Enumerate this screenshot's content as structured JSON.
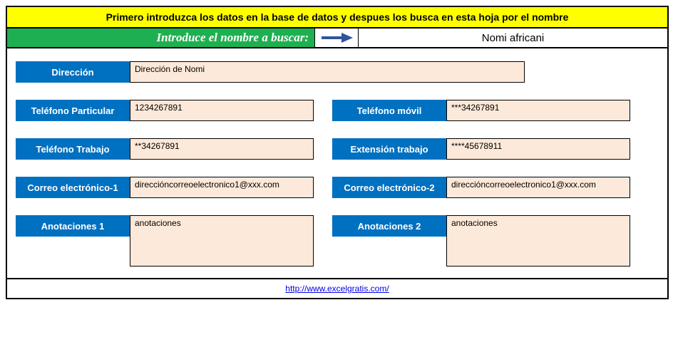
{
  "header": {
    "instruction": "Primero introduzca los datos en la base de datos y despues los busca en esta hoja por el nombre",
    "search_prompt": "Introduce el nombre a buscar:",
    "search_value": "Nomi africani"
  },
  "fields": {
    "direccion": {
      "label": "Dirección",
      "value": "Dirección de Nomi"
    },
    "tel_particular": {
      "label": "Teléfono Particular",
      "value": "1234267891"
    },
    "tel_movil": {
      "label": "Teléfono móvil",
      "value": "***34267891"
    },
    "tel_trabajo": {
      "label": "Teléfono Trabajo",
      "value": "**34267891"
    },
    "ext_trabajo": {
      "label": "Extensión trabajo",
      "value": "****45678911"
    },
    "correo1": {
      "label": "Correo electrónico-1",
      "value": "direccióncorreoelectronico1@xxx.com"
    },
    "correo2": {
      "label": "Correo electrónico-2",
      "value": "direccióncorreoelectronico1@xxx.com"
    },
    "anot1": {
      "label": "Anotaciones 1",
      "value": "anotaciones"
    },
    "anot2": {
      "label": "Anotaciones 2",
      "value": "anotaciones"
    }
  },
  "footer": {
    "link_text": "http://www.excelgratis.com/",
    "link_href": "http://www.excelgratis.com/"
  }
}
